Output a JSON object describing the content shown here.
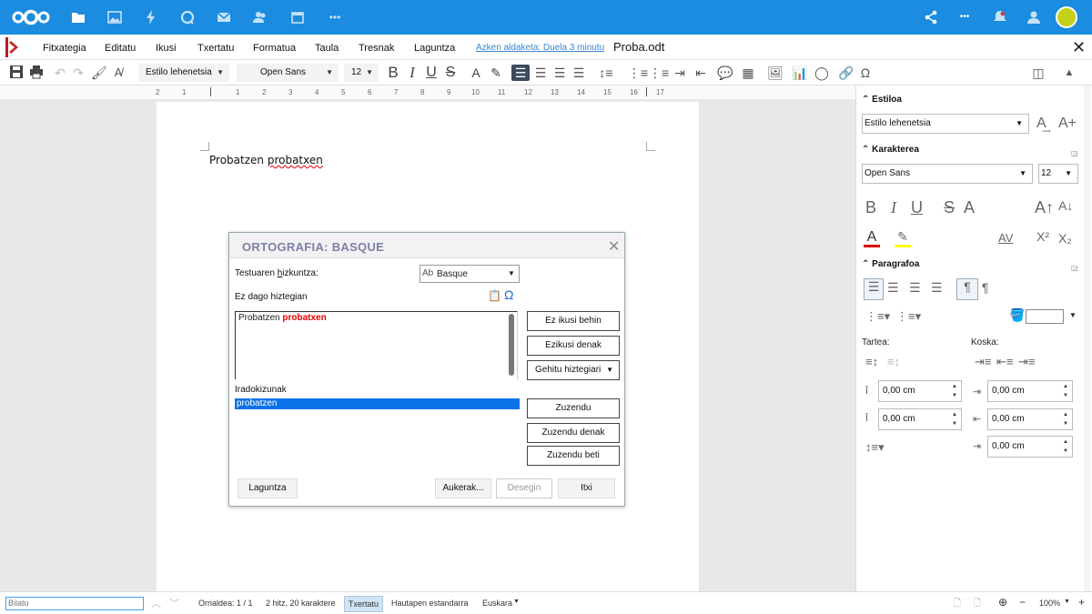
{
  "menu": {
    "items": [
      "Fitxategia",
      "Editatu",
      "Ikusi",
      "Txertatu",
      "Formatua",
      "Taula",
      "Tresnak",
      "Laguntza"
    ],
    "last_change": "Azken aldaketa: Duela 3 minutu",
    "doc_title": "Proba.odt"
  },
  "toolbar": {
    "style": "Estilo lehenetsia",
    "font": "Open Sans",
    "size": "12"
  },
  "ruler": {
    "numbers": [
      "2",
      "1",
      "1",
      "2",
      "3",
      "4",
      "5",
      "6",
      "7",
      "8",
      "9",
      "10",
      "11",
      "12",
      "13",
      "14",
      "15",
      "16",
      "17"
    ]
  },
  "document": {
    "text_a": "Probatzen ",
    "text_b": "probatxen"
  },
  "dialog": {
    "title": "ORTOGRAFIA: BASQUE",
    "language_label_pre": "Testuaren ",
    "language_label_u": "h",
    "language_label_post": "izkuntza:",
    "language_value": "Basque",
    "not_in_dict_label": "Ez dago hiztegian",
    "sentence_ok": "Probatzen ",
    "sentence_err": "probatxen",
    "ignore_once": "Ez ikusi behin",
    "ignore_all": "Ezikusi denak",
    "add_dict": "Gehitu hiztegiari",
    "suggestions_label": "Iradokizunak",
    "suggestion": "probatzen",
    "correct": "Zuzendu",
    "correct_all": "Zuzendu denak",
    "autocorrect": "Zuzendu beti",
    "help": "Laguntza",
    "options": "Aukerak...",
    "undo": "Desegin",
    "close": "Itxi"
  },
  "sidebar": {
    "style_head": "Estiloa",
    "style_value": "Estilo lehenetsia",
    "char_head": "Karakterea",
    "font_value": "Open Sans",
    "size_value": "12",
    "para_head": "Paragrafoa",
    "spacing_label": "Tartea:",
    "indent_label": "Koska:",
    "above": "0,00 cm",
    "below": "0,00 cm",
    "before": "0,00 cm",
    "after": "0,00 cm",
    "first": "0,00 cm"
  },
  "status": {
    "search": "Bilatu",
    "page": "Orrialdea: 1 / 1",
    "words": "2 hitz, 20 karaktere",
    "mode": "Txertatu",
    "selection": "Hautapen estandarra",
    "language": "Euskara",
    "zoom": "100%"
  },
  "colors": {
    "nc_blue": "#1b8ce0",
    "accent": "#0a72e8",
    "error": "#e00000",
    "dialog_title": "#7d7fa6"
  }
}
